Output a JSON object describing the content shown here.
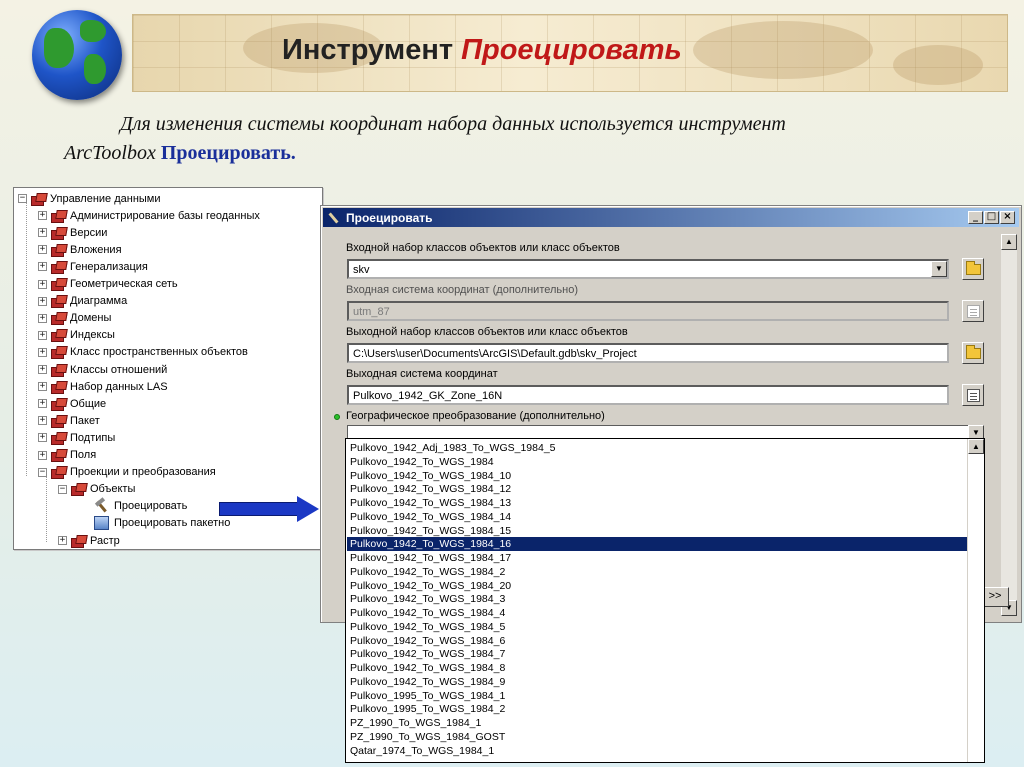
{
  "slide": {
    "title_part1": "Инструмент ",
    "title_part2": "Проецировать",
    "subtitle_line1": "Для изменения системы координат набора данных используется инструмент",
    "subtitle_line2_prefix": "ArcToolbox ",
    "subtitle_line2_tool": "Проецировать."
  },
  "tree": {
    "root": "Управление данными",
    "items": [
      "Администрирование базы геоданных",
      "Версии",
      "Вложения",
      "Генерализация",
      "Геометрическая сеть",
      "Диаграмма",
      "Домены",
      "Индексы",
      "Класс пространственных объектов",
      "Классы отношений",
      "Набор данных LAS",
      "Общие",
      "Пакет",
      "Подтипы",
      "Поля",
      "Проекции и преобразования"
    ],
    "sub": "Объекты",
    "tool1": "Проецировать",
    "tool2": "Проецировать пакетно",
    "last": "Растр"
  },
  "dialog": {
    "title": "Проецировать",
    "input_label": "Входной набор классов объектов или класс объектов",
    "input_value": "skv",
    "in_cs_label": "Входная система координат (дополнительно)",
    "in_cs_value": "utm_87",
    "output_label": "Выходной набор классов объектов или класс объектов",
    "output_value": "C:\\Users\\user\\Documents\\ArcGIS\\Default.gdb\\skv_Project",
    "out_cs_label": "Выходная система координат",
    "out_cs_value": "Pulkovo_1942_GK_Zone_16N",
    "geo_label": "Географическое преобразование (дополнительно)",
    "next_label": ">>"
  },
  "transform_list": {
    "items": [
      "Pulkovo_1942_Adj_1983_To_WGS_1984_5",
      "Pulkovo_1942_To_WGS_1984",
      "Pulkovo_1942_To_WGS_1984_10",
      "Pulkovo_1942_To_WGS_1984_12",
      "Pulkovo_1942_To_WGS_1984_13",
      "Pulkovo_1942_To_WGS_1984_14",
      "Pulkovo_1942_To_WGS_1984_15",
      "Pulkovo_1942_To_WGS_1984_16",
      "Pulkovo_1942_To_WGS_1984_17",
      "Pulkovo_1942_To_WGS_1984_2",
      "Pulkovo_1942_To_WGS_1984_20",
      "Pulkovo_1942_To_WGS_1984_3",
      "Pulkovo_1942_To_WGS_1984_4",
      "Pulkovo_1942_To_WGS_1984_5",
      "Pulkovo_1942_To_WGS_1984_6",
      "Pulkovo_1942_To_WGS_1984_7",
      "Pulkovo_1942_To_WGS_1984_8",
      "Pulkovo_1942_To_WGS_1984_9",
      "Pulkovo_1995_To_WGS_1984_1",
      "Pulkovo_1995_To_WGS_1984_2",
      "PZ_1990_To_WGS_1984_1",
      "PZ_1990_To_WGS_1984_GOST",
      "Qatar_1974_To_WGS_1984_1"
    ],
    "selected": "Pulkovo_1942_To_WGS_1984_16"
  },
  "colors": {
    "title_accent": "#c01818",
    "tool_link": "#1a2f9a",
    "arrow": "#1b38c4",
    "selection": "#0a246a"
  }
}
